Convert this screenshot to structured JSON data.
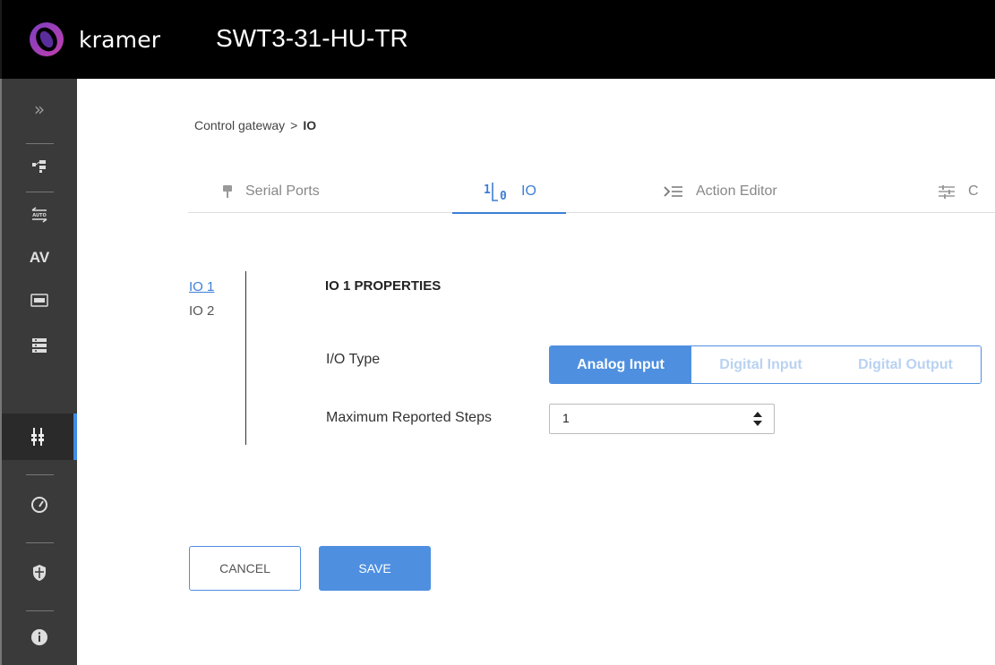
{
  "header": {
    "brand": "kramer",
    "device_name": "SWT3-31-HU-TR"
  },
  "sidebar": {
    "items": [
      {
        "name": "expand",
        "icon": "double-chevron-right-icon",
        "label": "»"
      },
      {
        "name": "routing",
        "icon": "routing-icon"
      },
      {
        "name": "auto-switching",
        "icon": "auto-switch-icon"
      },
      {
        "name": "av",
        "icon": "av-text-icon",
        "label": "AV"
      },
      {
        "name": "edid",
        "icon": "edid-icon"
      },
      {
        "name": "control",
        "icon": "control-settings-icon"
      },
      {
        "name": "control-gateway",
        "icon": "control-gateway-icon",
        "active": true
      },
      {
        "name": "status",
        "icon": "gauge-icon"
      },
      {
        "name": "security",
        "icon": "shield-icon"
      },
      {
        "name": "about",
        "icon": "info-icon"
      }
    ]
  },
  "breadcrumb": {
    "parent": "Control gateway",
    "separator": ">",
    "current": "IO"
  },
  "tabs": [
    {
      "label": "Serial Ports",
      "icon": "serial-port-icon"
    },
    {
      "label": "IO",
      "icon": "io-icon",
      "active": true
    },
    {
      "label": "Action Editor",
      "icon": "action-editor-icon"
    },
    {
      "label": "C",
      "icon": "sliders-icon"
    }
  ],
  "io_list": {
    "items": [
      "IO 1",
      "IO 2"
    ],
    "selected": "IO 1"
  },
  "properties": {
    "title": "IO 1 PROPERTIES",
    "io_type_label": "I/O Type",
    "io_type_options": [
      "Analog Input",
      "Digital Input",
      "Digital Output"
    ],
    "io_type_selected": "Analog Input",
    "max_steps_label": "Maximum Reported Steps",
    "max_steps_value": "1"
  },
  "actions": {
    "cancel": "CANCEL",
    "save": "SAVE"
  },
  "colors": {
    "accent": "#4e8fe0",
    "active_text": "#3d7fd6",
    "sidebar_bg": "#3a3a3a",
    "topbar_bg": "#000000"
  }
}
